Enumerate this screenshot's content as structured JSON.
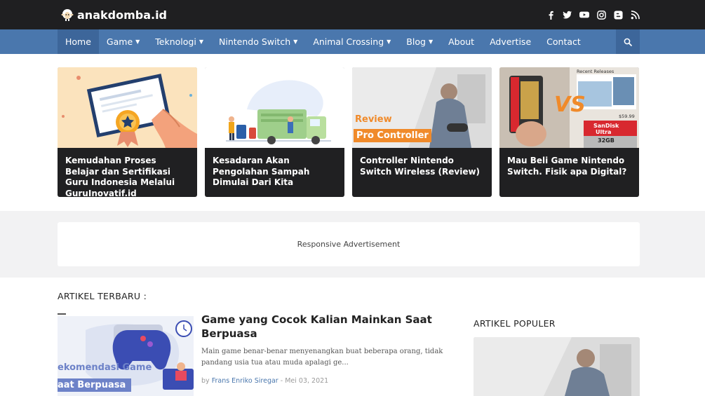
{
  "header": {
    "site_name": "anakdomba.id",
    "social_icons": [
      "facebook-icon",
      "twitter-icon",
      "youtube-icon",
      "instagram-icon",
      "blogger-icon",
      "rss-icon"
    ]
  },
  "nav": {
    "items": [
      {
        "label": "Home",
        "dropdown": false,
        "active": true
      },
      {
        "label": "Game",
        "dropdown": true
      },
      {
        "label": "Teknologi",
        "dropdown": true
      },
      {
        "label": "Nintendo Switch",
        "dropdown": true
      },
      {
        "label": "Animal Crossing",
        "dropdown": true
      },
      {
        "label": "Blog",
        "dropdown": true
      },
      {
        "label": "About",
        "dropdown": false
      },
      {
        "label": "Advertise",
        "dropdown": false
      },
      {
        "label": "Contact",
        "dropdown": false
      }
    ]
  },
  "featured": [
    {
      "title": "Kemudahan Proses Belajar dan Sertifikasi Guru Indonesia Melalui GuruInovatif.id"
    },
    {
      "title": "Kesadaran Akan Pengolahan Sampah Dimulai Dari Kita"
    },
    {
      "title": "Controller Nintendo Switch Wireless (Review)",
      "img_text_1": "Review",
      "img_text_2": "Pro Controller"
    },
    {
      "title": "Mau Beli Game Nintendo Switch. Fisik apa Digital?",
      "img_text_1": "Recent Releases",
      "img_text_2": "VS",
      "img_text_3": "$59.99",
      "img_text_4": "SanDisk",
      "img_text_5": "Ultra",
      "img_text_6": "32GB"
    }
  ],
  "ad": {
    "label": "Responsive Advertisement"
  },
  "latest": {
    "heading": "ARTIKEL TERBARU :",
    "post": {
      "title": "Game yang Cocok Kalian Mainkan Saat Berpuasa",
      "excerpt": "Main game benar-benar menyenangkan buat beberapa orang, tidak pandang usia tua atau muda apalagi ge...",
      "by": "by",
      "author": "Frans Enriko Siregar",
      "sep": "-",
      "date": "Mei 03, 2021",
      "thumb_text_1": "ekomendasi Game",
      "thumb_text_2": "aat Berpuasa"
    }
  },
  "popular": {
    "heading": "ARTIKEL POPULER"
  },
  "colors": {
    "topbar": "#1f1f21",
    "nav": "#4a77ad",
    "nav_active": "#3d669a",
    "accent_orange": "#f08a2a"
  }
}
